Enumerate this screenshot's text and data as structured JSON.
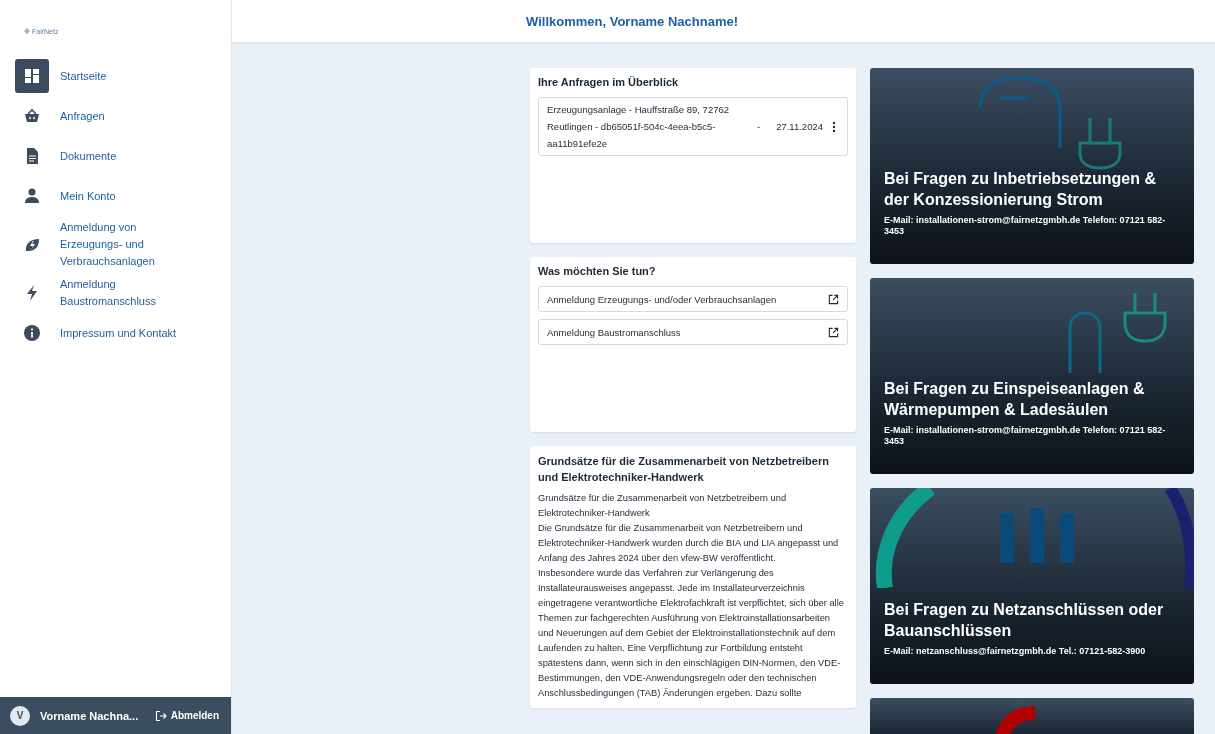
{
  "brand": {
    "name": "FairNetz"
  },
  "sidebar": {
    "items": [
      {
        "label": "Startseite",
        "selected": true
      },
      {
        "label": "Anfragen",
        "selected": false
      },
      {
        "label": "Dokumente",
        "selected": false
      },
      {
        "label": "Mein Konto",
        "selected": false
      },
      {
        "label": "Anmeldung von Erzeugungs- und Verbrauchsanlagen",
        "selected": false
      },
      {
        "label": "Anmeldung Baustromanschluss",
        "selected": false
      },
      {
        "label": "Impressum und Kontakt",
        "selected": false
      }
    ]
  },
  "user": {
    "initial": "V",
    "name": "Vorname Nachna...",
    "logout": "Abmelden"
  },
  "header": {
    "title": "Willkommen, Vorname Nachname!"
  },
  "requests": {
    "title": "Ihre Anfragen im Überblick",
    "items": [
      {
        "text": "Erzeugungsanlage - Hauffstraße 89, 72762 Reutlingen - db65051f-504c-4eea-b5c5-aa11b91efe2e",
        "separator": "-",
        "date": "27.11.2024"
      }
    ]
  },
  "actions": {
    "title": "Was möchten Sie tun?",
    "items": [
      {
        "label": "Anmeldung Erzeugungs- und/oder Verbrauchsanlagen"
      },
      {
        "label": "Anmeldung Baustromanschluss"
      }
    ]
  },
  "article": {
    "title": "Grundsätze für die Zusammenarbeit von Netzbetreibern und Elektrotechniker-Handwerk",
    "paragraphs": [
      "Grundsätze für die Zusammenarbeit von Netzbetreibern und Elektrotechniker-Handwerk",
      "Die Grundsätze für die Zusammenarbeit von Netzbetreibern und Elektrotechniker-Handwerk wurden durch die BIA und LIA angepasst und Anfang des Jahres 2024 über den vfew-BW veröffentlicht.",
      "Insbesondere wurde das Verfahren zur Verlängerung des Installateurausweises angepasst. Jede im Installateurverzeichnis eingetragene verantwortliche Elektrofachkraft ist verpflichtet, sich über alle Themen zur fachgerechten Ausführung von Elektroinstallationsarbeiten und Neuerungen auf dem Gebiet der Elektroinstallationstechnik auf dem Laufenden zu halten. Eine Verpflichtung zur Fortbildung entsteht spätestens dann, wenn sich in den einschlägigen DIN-Normen, den VDE-Bestimmungen, den VDE-Anwendungsregeln oder den technischen Anschlussbedingungen (TAB) Änderungen ergeben. Dazu sollte"
    ]
  },
  "contact_cards": [
    {
      "kind": "info",
      "title": "Bei Fragen zu Inbetriebsetzungen & der Konzessionierung Strom",
      "contact": "E-Mail: installationen-strom@fairnetzgmbh.de Telefon: 07121 582-3453"
    },
    {
      "kind": "info",
      "title": "Bei Fragen zu Einspeiseanlagen & Wärmepumpen & Ladesäulen",
      "contact": "E-Mail: installationen-strom@fairnetzgmbh.de Telefon: 07121 582-3453"
    },
    {
      "kind": "info",
      "title": "Bei Fragen zu Netzanschlüssen oder Bauanschlüssen",
      "contact": "E-Mail: netzanschluss@fairnetzgmbh.de Tel.: 07121-582-3900"
    },
    {
      "kind": "image"
    }
  ]
}
